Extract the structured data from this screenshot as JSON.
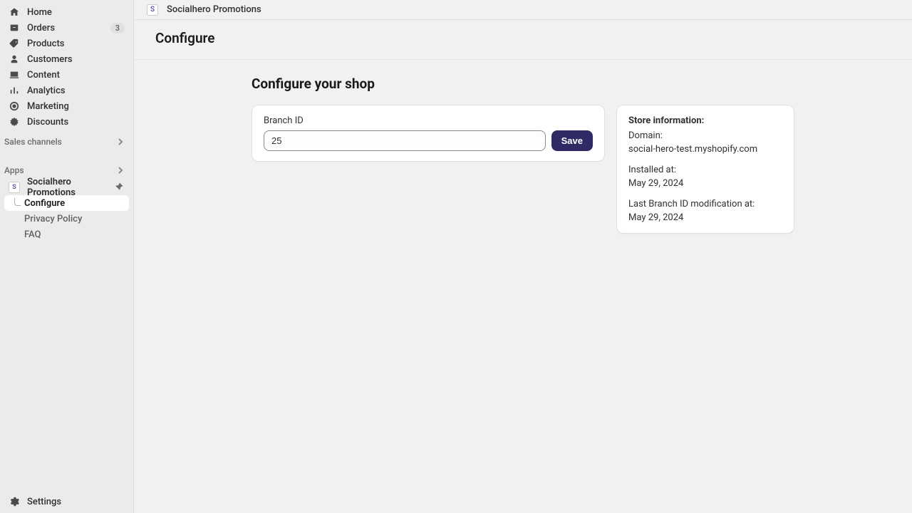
{
  "sidebar": {
    "main_nav": [
      {
        "label": "Home"
      },
      {
        "label": "Orders",
        "badge": "3"
      },
      {
        "label": "Products"
      },
      {
        "label": "Customers"
      },
      {
        "label": "Content"
      },
      {
        "label": "Analytics"
      },
      {
        "label": "Marketing"
      },
      {
        "label": "Discounts"
      }
    ],
    "sections": {
      "sales_channels": "Sales channels",
      "apps": "Apps"
    },
    "app": {
      "name": "Socialhero Promotions",
      "icon_letter": "S",
      "subitems": [
        {
          "label": "Configure",
          "selected": true
        },
        {
          "label": "Privacy Policy"
        },
        {
          "label": "FAQ"
        }
      ]
    },
    "settings": "Settings"
  },
  "breadcrumb": {
    "icon_letter": "S",
    "app_name": "Socialhero Promotions"
  },
  "page": {
    "title": "Configure",
    "section_title": "Configure your shop"
  },
  "form": {
    "branch_id_label": "Branch ID",
    "branch_id_value": "25",
    "save_label": "Save"
  },
  "info": {
    "header": "Store information:",
    "domain_label": "Domain:",
    "domain_value": "social-hero-test.myshopify.com",
    "installed_label": "Installed at:",
    "installed_value": "May 29, 2024",
    "modified_label": "Last Branch ID modification at:",
    "modified_value": "May 29, 2024"
  }
}
